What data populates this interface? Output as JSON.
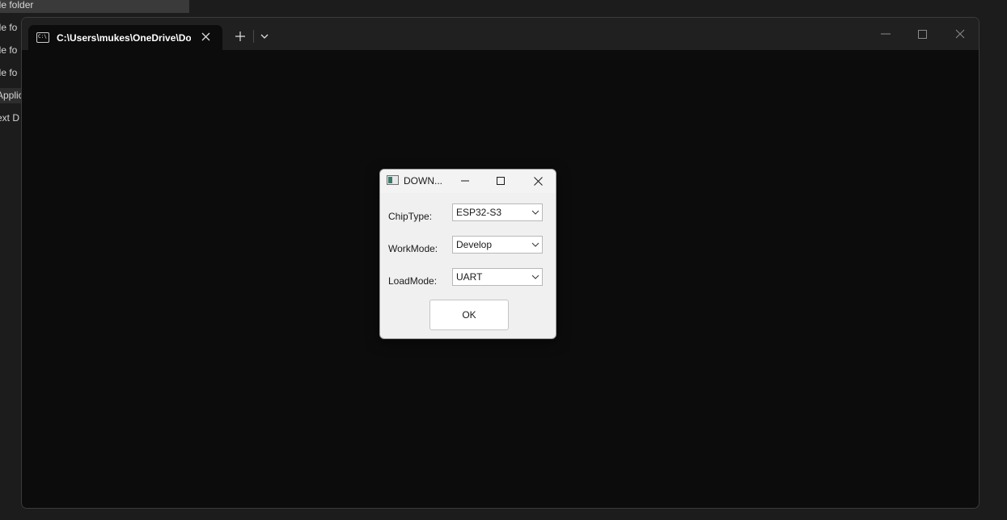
{
  "background": {
    "rows": [
      {
        "text": "ile folder",
        "state": "selected"
      },
      {
        "text": "ile fo",
        "state": "normal"
      },
      {
        "text": "ile fo",
        "state": "normal"
      },
      {
        "text": "ile fo",
        "state": "normal"
      },
      {
        "text": "Applic",
        "state": "hover"
      },
      {
        "text": "ext D",
        "state": "normal"
      }
    ]
  },
  "terminal": {
    "tab_title": "C:\\Users\\mukes\\OneDrive\\Do",
    "icons": {
      "tab": "terminal-icon",
      "close": "close-icon",
      "new_tab": "plus-icon",
      "dropdown": "chevron-down-icon",
      "minimize": "minimize-icon",
      "maximize": "maximize-icon",
      "window_close": "close-icon"
    },
    "new_tab_glyph": "+",
    "close_glyph": "✕"
  },
  "dialog": {
    "title": "DOWN...",
    "fields": [
      {
        "label": "ChipType:",
        "value": "ESP32-S3"
      },
      {
        "label": "WorkMode:",
        "value": "Develop"
      },
      {
        "label": "LoadMode:",
        "value": "UART"
      }
    ],
    "ok_label": "OK"
  },
  "colors": {
    "desktop": "#1c1c1c",
    "terminal_bg": "#0c0c0c",
    "titlebar": "#202020",
    "dialog_bg": "#f0f0f0"
  }
}
